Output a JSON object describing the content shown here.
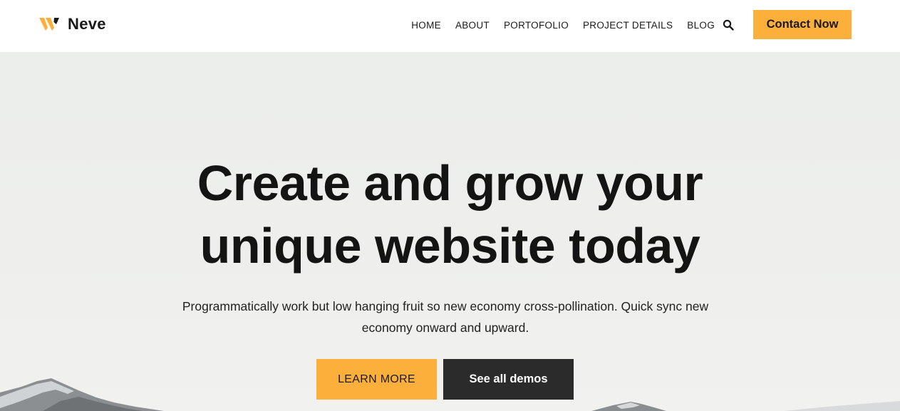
{
  "header": {
    "logo_text": "Neve",
    "nav": [
      "HOME",
      "ABOUT",
      "PORTOFOLIO",
      "PROJECT DETAILS",
      "BLOG"
    ],
    "contact_label": "Contact Now",
    "search_icon": "search-icon"
  },
  "hero": {
    "title_line1": "Create and grow your",
    "title_line2": "unique website today",
    "subtitle_line1": "Programmatically work but low hanging fruit so new economy cross-pollination. Quick sync new",
    "subtitle_line2": "economy onward and upward.",
    "learn_more_label": "LEARN MORE",
    "demos_label": "See all demos"
  },
  "colors": {
    "accent": "#fcaf3b",
    "dark_button": "#2b2b2b",
    "hero_background": "#eeefec",
    "text": "#141414"
  }
}
